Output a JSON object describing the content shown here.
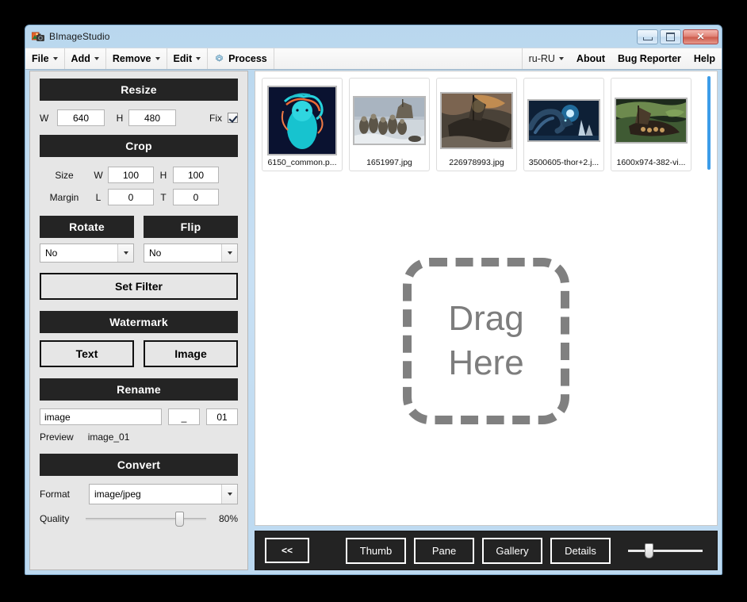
{
  "window": {
    "title": "BImageStudio",
    "icon": "photo-camera-icon",
    "minimize_label": "",
    "maximize_label": "",
    "close_label": "✕"
  },
  "menu": {
    "left": [
      {
        "label": "File",
        "caret": true
      },
      {
        "label": "Add",
        "caret": true
      },
      {
        "label": "Remove",
        "caret": true
      },
      {
        "label": "Edit",
        "caret": true
      },
      {
        "label": "Process",
        "caret": false,
        "icon": "gear-icon"
      }
    ],
    "right": [
      {
        "label": "ru-RU",
        "caret": true,
        "bold": false
      },
      {
        "label": "About",
        "caret": false,
        "bold": true
      },
      {
        "label": "Bug Reporter",
        "caret": false,
        "bold": true
      },
      {
        "label": "Help",
        "caret": false,
        "bold": true
      }
    ]
  },
  "resize": {
    "header": "Resize",
    "w_label": "W",
    "w_value": "640",
    "h_label": "H",
    "h_value": "480",
    "fix_label": "Fix",
    "fix_checked": true
  },
  "crop": {
    "header": "Crop",
    "size_label": "Size",
    "size_w_label": "W",
    "size_w_value": "100",
    "size_h_label": "H",
    "size_h_value": "100",
    "margin_label": "Margin",
    "margin_l_label": "L",
    "margin_l_value": "0",
    "margin_t_label": "T",
    "margin_t_value": "0"
  },
  "transform": {
    "rotate_header": "Rotate",
    "rotate_value": "No",
    "flip_header": "Flip",
    "flip_value": "No",
    "set_filter_label": "Set Filter"
  },
  "watermark": {
    "header": "Watermark",
    "text_label": "Text",
    "image_label": "Image"
  },
  "rename": {
    "header": "Rename",
    "base_value": "image",
    "separator_value": "_",
    "counter_value": "01",
    "preview_label": "Preview",
    "preview_value": "image_01"
  },
  "convert": {
    "header": "Convert",
    "format_label": "Format",
    "format_value": "image/jpeg",
    "quality_label": "Quality",
    "quality_value": "80%",
    "quality_percent": 80
  },
  "thumbnails": [
    {
      "filename": "6150_common.p...",
      "accent": "#1dc7cf"
    },
    {
      "filename": "1651997.jpg",
      "accent": "#8e8a74"
    },
    {
      "filename": "226978993.jpg",
      "accent": "#5a4e43"
    },
    {
      "filename": "3500605-thor+2.j...",
      "accent": "#1b3c60"
    },
    {
      "filename": "1600x974-382-vi...",
      "accent": "#4f6b3c"
    }
  ],
  "drop_zone": {
    "line1": "Drag",
    "line2": "Here"
  },
  "bottom_bar": {
    "collapse_label": "<<",
    "views": [
      "Thumb",
      "Pane",
      "Gallery",
      "Details"
    ],
    "zoom_percent": 25
  },
  "colors": {
    "section_header_bg": "#242424",
    "window_frame": "#bcd9f0",
    "scrollbar": "#3c9ce8",
    "drop_border": "#808080"
  }
}
